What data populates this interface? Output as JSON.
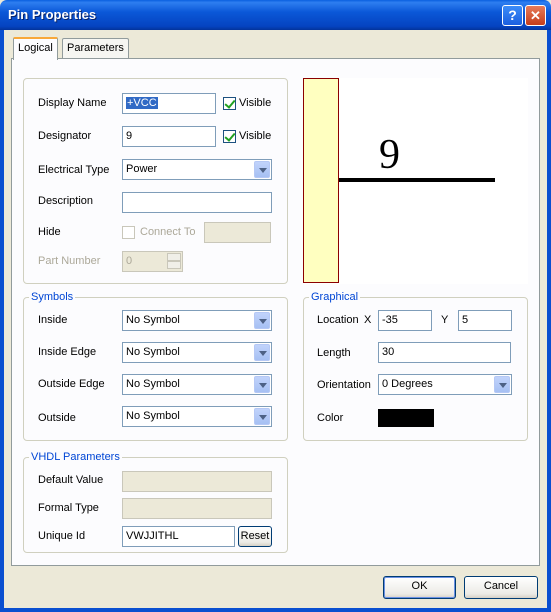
{
  "window": {
    "title": "Pin Properties",
    "help_glyph": "?",
    "close_glyph": "✕"
  },
  "tabs": [
    {
      "label": "Logical"
    },
    {
      "label": "Parameters"
    }
  ],
  "fields": {
    "display_name": {
      "label": "Display Name",
      "value": "+VCC",
      "visible_label": "Visible",
      "visible_checked": true
    },
    "designator": {
      "label": "Designator",
      "value": "9",
      "visible_label": "Visible",
      "visible_checked": true
    },
    "electrical_type": {
      "label": "Electrical Type",
      "value": "Power"
    },
    "description": {
      "label": "Description",
      "value": ""
    },
    "hide": {
      "label": "Hide",
      "connect_to_label": "Connect To",
      "connect_to_value": ""
    },
    "part_number": {
      "label": "Part Number",
      "value": "0"
    }
  },
  "preview": {
    "designator": "9",
    "body_color": "#FFFFC0",
    "pin_color": "#000000"
  },
  "symbols": {
    "title": "Symbols",
    "inside": {
      "label": "Inside",
      "value": "No Symbol"
    },
    "inside_edge": {
      "label": "Inside Edge",
      "value": "No Symbol"
    },
    "outside_edge": {
      "label": "Outside Edge",
      "value": "No Symbol"
    },
    "outside": {
      "label": "Outside",
      "value": "No Symbol"
    }
  },
  "graphical": {
    "title": "Graphical",
    "location_label": "Location",
    "x_label": "X",
    "x_value": "-35",
    "y_label": "Y",
    "y_value": "5",
    "length_label": "Length",
    "length_value": "30",
    "orientation_label": "Orientation",
    "orientation_value": "0 Degrees",
    "color_label": "Color",
    "color_value": "#000000"
  },
  "vhdl": {
    "title": "VHDL Parameters",
    "default_value": {
      "label": "Default Value",
      "value": ""
    },
    "formal_type": {
      "label": "Formal Type",
      "value": ""
    },
    "unique_id": {
      "label": "Unique Id",
      "value": "VWJJITHL"
    },
    "reset_label": "Reset"
  },
  "buttons": {
    "ok": "OK",
    "cancel": "Cancel"
  }
}
